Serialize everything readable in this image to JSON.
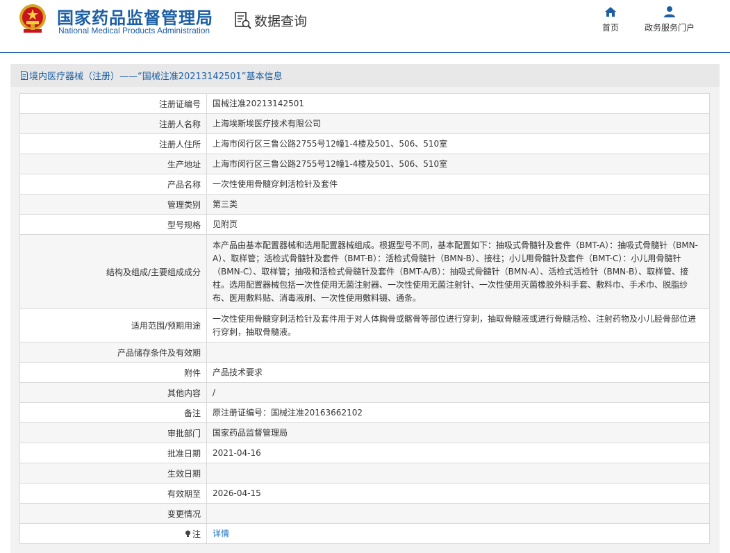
{
  "header": {
    "org_cn": "国家药品监督管理局",
    "org_en": "National Medical Products Administration",
    "data_query": "数据查询",
    "nav": [
      {
        "label": "首页",
        "icon": "home-icon"
      },
      {
        "label": "政务服务门户",
        "icon": "user-icon"
      }
    ],
    "brand_color": "#1b5fa5"
  },
  "panel": {
    "title": "境内医疗器械（注册）——“国械注准20213142501”基本信息"
  },
  "rows": [
    {
      "label": "注册证编号",
      "value": "国械注准20213142501"
    },
    {
      "label": "注册人名称",
      "value": "上海埃斯埃医疗技术有限公司"
    },
    {
      "label": "注册人住所",
      "value": "上海市闵行区三鲁公路2755号12幢1-4楼及501、506、510室"
    },
    {
      "label": "生产地址",
      "value": "上海市闵行区三鲁公路2755号12幢1-4楼及501、506、510室"
    },
    {
      "label": "产品名称",
      "value": "一次性使用骨髓穿刺活检针及套件"
    },
    {
      "label": "管理类别",
      "value": "第三类"
    },
    {
      "label": "型号规格",
      "value": "见附页"
    },
    {
      "label": "结构及组成/主要组成成分",
      "value": "本产品由基本配置器械和选用配置器械组成。根据型号不同，基本配置如下：抽吸式骨髓针及套件（BMT-A）：抽吸式骨髓针（BMN-A）、取样管；活检式骨髓针及套件（BMT-B）：活检式骨髓针（BMN-B）、接柱；小儿用骨髓针及套件（BMT-C）：小儿用骨髓针（BMN-C）、取样管；抽吸和活检式骨髓针及套件（BMT-A/B）：抽吸式骨髓针（BMN-A）、活检式活检针（BMN-B）、取样管、接柱。选用配置器械包括一次性使用无菌注射器、一次性使用无菌注射针、一次性使用灭菌橡胶外科手套、敷料巾、手术巾、脱脂纱布、医用敷料贴、消毒液刷、一次性使用敷料镊、通条。"
    },
    {
      "label": "适用范围/预期用途",
      "value": "一次性使用骨髓穿刺活检针及套件用于对人体胸骨或髂骨等部位进行穿刺，抽取骨髓液或进行骨髓活检、注射药物及小儿胫骨部位进行穿刺，抽取骨髓液。"
    },
    {
      "label": "产品储存条件及有效期",
      "value": ""
    },
    {
      "label": "附件",
      "value": "产品技术要求"
    },
    {
      "label": "其他内容",
      "value": "/"
    },
    {
      "label": "备注",
      "value": "原注册证编号：国械注准20163662102"
    },
    {
      "label": "审批部门",
      "value": "国家药品监督管理局"
    },
    {
      "label": "批准日期",
      "value": "2021-04-16"
    },
    {
      "label": "生效日期",
      "value": ""
    },
    {
      "label": "有效期至",
      "value": "2026-04-15"
    },
    {
      "label": "变更情况",
      "value": ""
    },
    {
      "label": "注",
      "value": "详情"
    }
  ]
}
